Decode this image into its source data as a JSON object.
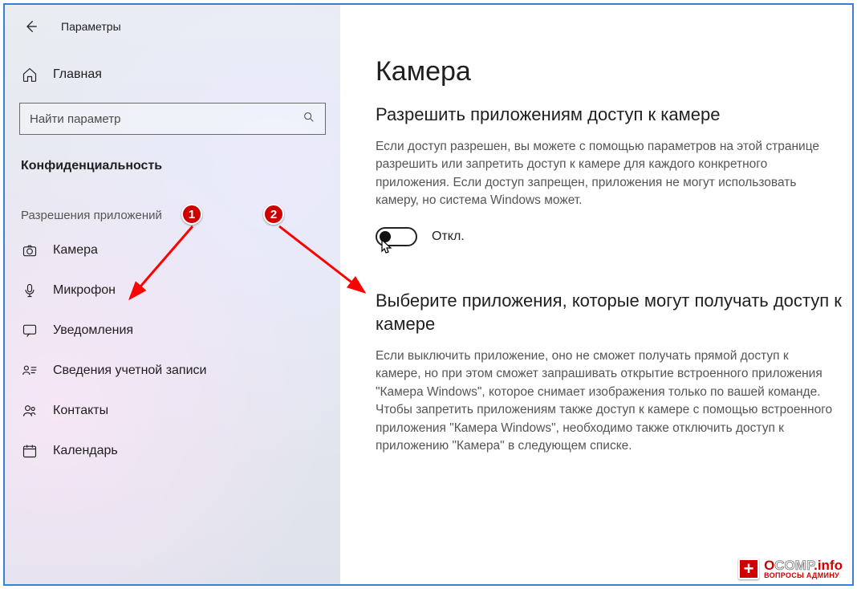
{
  "window_title": "Параметры",
  "sidebar": {
    "home_label": "Главная",
    "search_placeholder": "Найти параметр",
    "category_title": "Конфиденциальность",
    "group_title": "Разрешения приложений",
    "items": [
      {
        "id": "camera",
        "label": "Камера",
        "icon": "camera"
      },
      {
        "id": "microphone",
        "label": "Микрофон",
        "icon": "microphone"
      },
      {
        "id": "notifications",
        "label": "Уведомления",
        "icon": "notifications"
      },
      {
        "id": "account-info",
        "label": "Сведения учетной записи",
        "icon": "account-info"
      },
      {
        "id": "contacts",
        "label": "Контакты",
        "icon": "contacts"
      },
      {
        "id": "calendar",
        "label": "Календарь",
        "icon": "calendar"
      }
    ]
  },
  "content": {
    "page_title": "Камера",
    "section1": {
      "heading": "Разрешить приложениям доступ к камере",
      "body": "Если доступ разрешен, вы можете с помощью параметров на этой странице разрешить или запретить доступ к камере для каждого конкретного приложения. Если доступ запрещен, приложения не могут использовать камеру, но система Windows может.",
      "toggle_state": "off",
      "toggle_label": "Откл."
    },
    "section2": {
      "heading": "Выберите приложения, которые могут получать доступ к камере",
      "body": "Если выключить приложение, оно не сможет получать прямой доступ к камере, но при этом сможет запрашивать открытие встроенного приложения \"Камера Windows\", которое снимает изображения только по вашей команде. Чтобы запретить приложениям также доступ к камере с помощью встроенного приложения \"Камера Windows\", необходимо также отключить доступ к приложению \"Камера\" в следующем списке."
    }
  },
  "annotations": {
    "badge1": "1",
    "badge2": "2"
  },
  "watermark": {
    "site": "OCOMP.info",
    "sub": "ВОПРОСЫ АДМИНУ"
  }
}
